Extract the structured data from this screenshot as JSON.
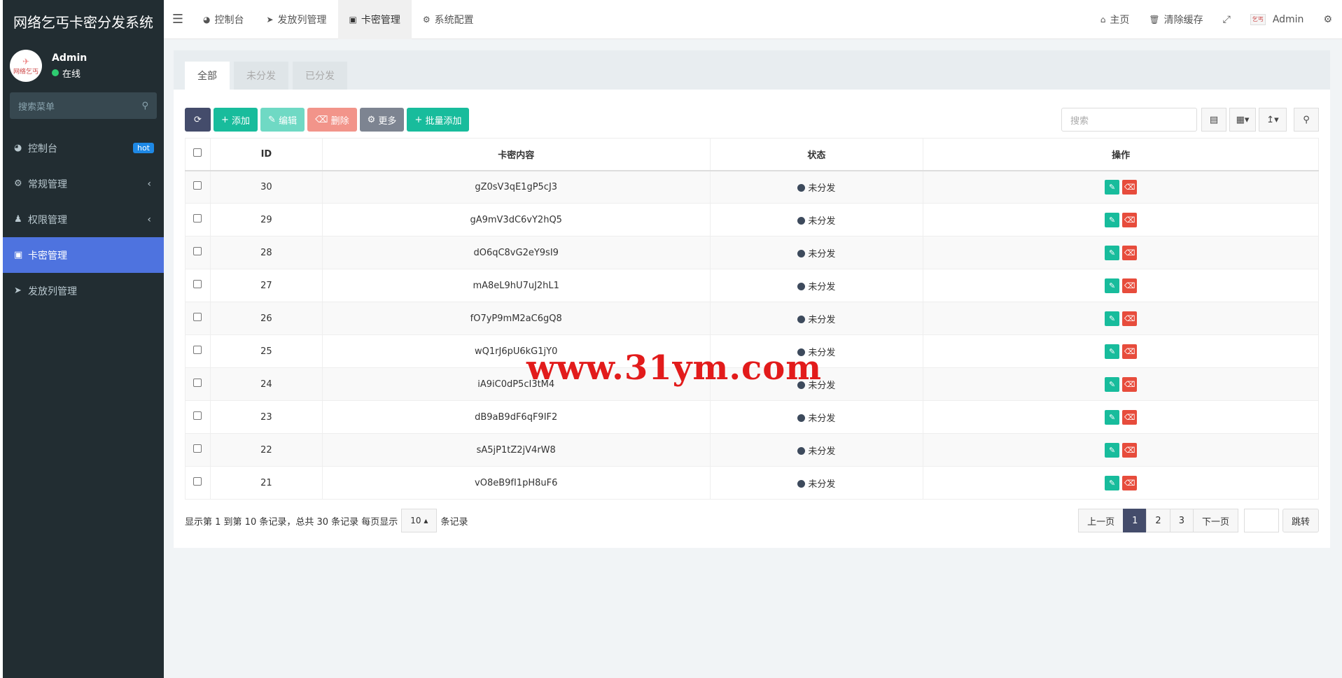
{
  "app": {
    "title": "网络乞丐卡密分发系统"
  },
  "user": {
    "name": "Admin",
    "status": "在线",
    "avatar_text": "网络乞丐",
    "avatar_small_text": "乞丐"
  },
  "sidebar": {
    "search_placeholder": "搜索菜单",
    "items": [
      {
        "label": "控制台",
        "badge": "hot",
        "icon": "dashboard-icon"
      },
      {
        "label": "常规管理",
        "icon": "cogs-icon"
      },
      {
        "label": "权限管理",
        "icon": "users-icon"
      },
      {
        "label": "卡密管理",
        "icon": "card-icon",
        "active": true
      },
      {
        "label": "发放列管理",
        "icon": "paper-plane-icon"
      }
    ]
  },
  "topnav": {
    "tabs": [
      {
        "label": "控制台"
      },
      {
        "label": "发放列管理"
      },
      {
        "label": "卡密管理"
      },
      {
        "label": "系统配置"
      }
    ],
    "right": {
      "home": "主页",
      "clear_cache": "清除缓存",
      "admin": "Admin"
    }
  },
  "filter_tabs": [
    "全部",
    "未分发",
    "已分发"
  ],
  "toolbar": {
    "add": "添加",
    "edit": "编辑",
    "delete": "删除",
    "more": "更多",
    "batch_add": "批量添加",
    "search_placeholder": "搜索"
  },
  "table": {
    "headers": {
      "id": "ID",
      "content": "卡密内容",
      "status": "状态",
      "ops": "操作"
    },
    "rows": [
      {
        "id": "30",
        "content": "gZ0sV3qE1gP5cJ3",
        "status": "未分发"
      },
      {
        "id": "29",
        "content": "gA9mV3dC6vY2hQ5",
        "status": "未分发"
      },
      {
        "id": "28",
        "content": "dO6qC8vG2eY9sI9",
        "status": "未分发"
      },
      {
        "id": "27",
        "content": "mA8eL9hU7uJ2hL1",
        "status": "未分发"
      },
      {
        "id": "26",
        "content": "fO7yP9mM2aC6gQ8",
        "status": "未分发"
      },
      {
        "id": "25",
        "content": "wQ1rJ6pU6kG1jY0",
        "status": "未分发"
      },
      {
        "id": "24",
        "content": "iA9iC0dP5cI3tM4",
        "status": "未分发"
      },
      {
        "id": "23",
        "content": "dB9aB9dF6qF9IF2",
        "status": "未分发"
      },
      {
        "id": "22",
        "content": "sA5jP1tZ2jV4rW8",
        "status": "未分发"
      },
      {
        "id": "21",
        "content": "vO8eB9fI1pH8uF6",
        "status": "未分发"
      }
    ]
  },
  "footer": {
    "summary": "显示第 1 到第 10 条记录，总共 30 条记录 每页显示",
    "page_size": "10",
    "suffix": "条记录",
    "prev": "上一页",
    "pages": [
      "1",
      "2",
      "3"
    ],
    "next": "下一页",
    "jump": "跳转"
  },
  "watermark": "www.31ym.com"
}
